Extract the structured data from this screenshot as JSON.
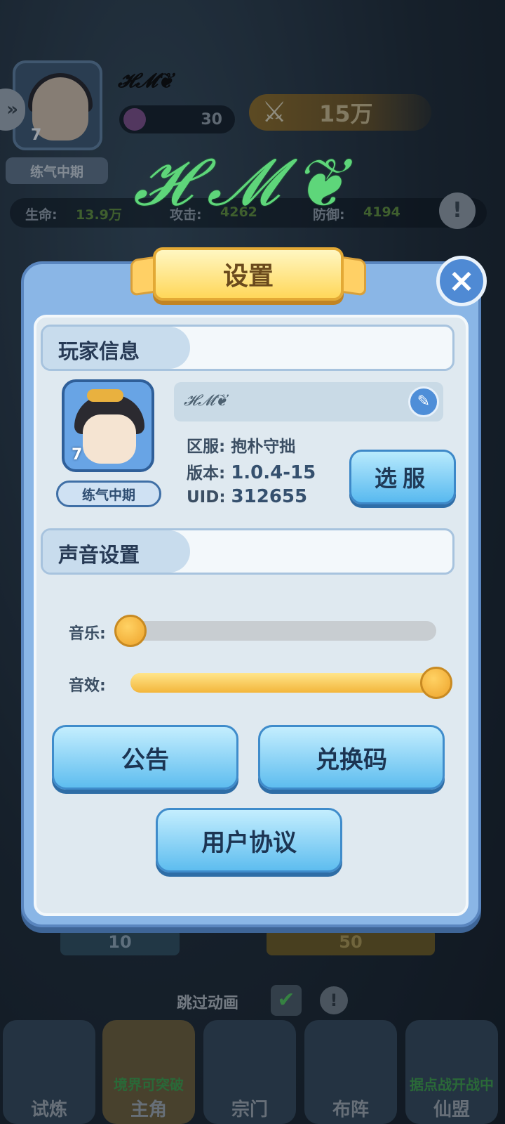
{
  "hud": {
    "player_name": "𝓗𝓜❦",
    "level": "7",
    "energy": "30",
    "power": "15万",
    "realm": "练气中期",
    "stats": {
      "hp_label": "生命:",
      "hp_value": "13.9万",
      "atk_label": "攻击:",
      "atk_value": "4262",
      "def_label": "防御:",
      "def_value": "4194"
    }
  },
  "watermark": "𝓗𝓜❦",
  "modal": {
    "title": "设置",
    "close_icon": "close-icon",
    "player_info": {
      "section_title": "玩家信息",
      "level": "7",
      "realm": "练气中期",
      "name": "𝓗𝓜❦",
      "server_label": "区服:",
      "server_value": "抱朴守拙",
      "version_label": "版本:",
      "version_value": "1.0.4-15",
      "uid_label": "UID:",
      "uid_value": "312655",
      "select_server_button": "选服"
    },
    "sound": {
      "section_title": "声音设置",
      "music_label": "音乐:",
      "music_level": 0.0,
      "sfx_label": "音效:",
      "sfx_level": 1.0
    },
    "buttons": {
      "announcement": "公告",
      "redeem_code": "兑换码",
      "user_agreement": "用户协议"
    }
  },
  "behind": {
    "cost_left": "10",
    "cost_right": "50",
    "skip_animation": "跳过动画",
    "skip_checked": true
  },
  "nav": [
    {
      "label": "试炼",
      "badge": ""
    },
    {
      "label": "主角",
      "badge": "境界可突破"
    },
    {
      "label": "宗门",
      "badge": ""
    },
    {
      "label": "布阵",
      "badge": ""
    },
    {
      "label": "仙盟",
      "badge": "据点战开战中"
    }
  ]
}
